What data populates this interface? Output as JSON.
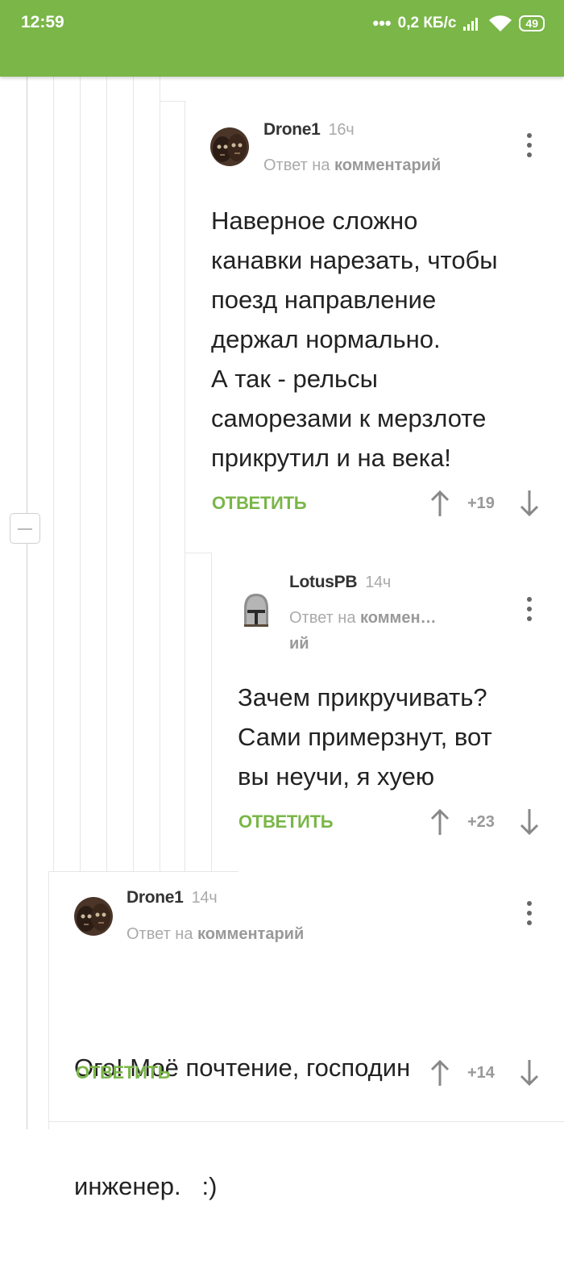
{
  "status_bar": {
    "time": "12:59",
    "speed": "0,2 КБ/с",
    "battery": "49"
  },
  "comments": [
    {
      "author": "Drone1",
      "time": "16ч",
      "reply_prefix": "Ответ на",
      "reply_target": "комментарий",
      "text_lines": [
        "Наверное сложно",
        "канавки нарезать, чтобы",
        "поезд направление",
        "держал нормально.",
        "А так - рельсы",
        "саморезами к мерзлоте",
        "прикрутил и на века!"
      ],
      "reply_label": "ОТВЕТИТЬ",
      "rating": "+19"
    },
    {
      "author": "LotusPB",
      "time": "14ч",
      "reply_prefix": "Ответ на",
      "reply_target_line1": "коммен…",
      "reply_target_line2": "ий",
      "text_lines": [
        "Зачем прикручивать?",
        "Сами примерзнут, вот",
        "вы неучи, я хуею"
      ],
      "reply_label": "ОТВЕТИТЬ",
      "rating": "+23"
    },
    {
      "author": "Drone1",
      "time": "14ч",
      "reply_prefix": "Ответ на",
      "reply_target": "комментарий",
      "text_lines": [
        "Ого! Моё почтение, господин",
        "инженер.   :)"
      ],
      "reply_label": "ОТВЕТИТЬ",
      "rating": "+14"
    }
  ],
  "colors": {
    "accent": "#7ab648",
    "status_bar": "#7ab648",
    "muted_text": "#aaaaaa",
    "icon": "#666666"
  },
  "icons": [
    "dots-signal-icon",
    "cellular-signal-icon",
    "wifi-icon",
    "battery-icon",
    "avatar",
    "more-vertical-icon",
    "upvote-arrow-icon",
    "downvote-arrow-icon",
    "collapse-thread-icon"
  ]
}
